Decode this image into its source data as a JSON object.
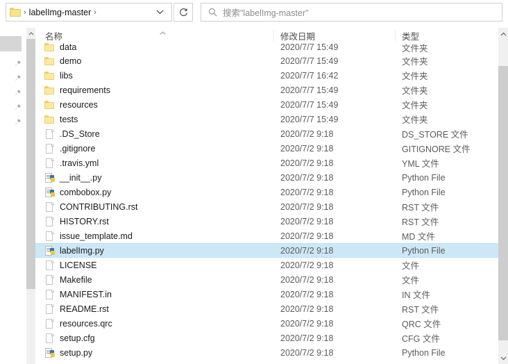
{
  "window": {
    "title": "labelImg-master"
  },
  "addressbar": {
    "folder_icon": "folder-icon",
    "separator": "›",
    "path_label": "labelImg-master",
    "trailing_separator": "›",
    "dropdown_icon": "chevron-down-icon",
    "refresh_icon": "refresh-icon"
  },
  "search": {
    "icon": "search-icon",
    "placeholder": "搜索\"labelImg-master\"",
    "value": ""
  },
  "sidebar": {
    "pin_icon": "pin-icon",
    "pin_count": 5
  },
  "columns": {
    "name": "名称",
    "date": "修改日期",
    "type": "类型",
    "sort_indicator": "sort-ascending-icon"
  },
  "colors": {
    "selection": "#cce8f7",
    "selection_border": "#b8e0f5",
    "folder": "#fde9a4",
    "header_text": "#4a4a4a",
    "row_text": "#1a1a1a",
    "secondary_text": "#5b5b5b"
  },
  "scrollbars": {
    "left_up_icon": "chevron-up-icon",
    "right_up_icon": "chevron-up-icon",
    "right_down_icon": "chevron-down-icon"
  },
  "files": [
    {
      "name": "data",
      "date": "2020/7/7 15:49",
      "type": "文件夹",
      "icon": "folder-icon",
      "selected": false,
      "clipped": true
    },
    {
      "name": "demo",
      "date": "2020/7/7 15:49",
      "type": "文件夹",
      "icon": "folder-icon",
      "selected": false
    },
    {
      "name": "libs",
      "date": "2020/7/7 16:42",
      "type": "文件夹",
      "icon": "folder-icon",
      "selected": false
    },
    {
      "name": "requirements",
      "date": "2020/7/7 15:49",
      "type": "文件夹",
      "icon": "folder-icon",
      "selected": false
    },
    {
      "name": "resources",
      "date": "2020/7/7 15:49",
      "type": "文件夹",
      "icon": "folder-icon",
      "selected": false
    },
    {
      "name": "tests",
      "date": "2020/7/7 15:49",
      "type": "文件夹",
      "icon": "folder-icon",
      "selected": false
    },
    {
      "name": ".DS_Store",
      "date": "2020/7/2 9:18",
      "type": "DS_STORE 文件",
      "icon": "file-icon",
      "selected": false
    },
    {
      "name": ".gitignore",
      "date": "2020/7/2 9:18",
      "type": "GITIGNORE 文件",
      "icon": "file-icon",
      "selected": false
    },
    {
      "name": ".travis.yml",
      "date": "2020/7/2 9:18",
      "type": "YML 文件",
      "icon": "file-icon",
      "selected": false
    },
    {
      "name": "__init__.py",
      "date": "2020/7/2 9:18",
      "type": "Python File",
      "icon": "python-file-icon",
      "selected": false
    },
    {
      "name": "combobox.py",
      "date": "2020/7/2 9:18",
      "type": "Python File",
      "icon": "python-file-icon",
      "selected": false
    },
    {
      "name": "CONTRIBUTING.rst",
      "date": "2020/7/2 9:18",
      "type": "RST 文件",
      "icon": "file-icon",
      "selected": false
    },
    {
      "name": "HISTORY.rst",
      "date": "2020/7/2 9:18",
      "type": "RST 文件",
      "icon": "file-icon",
      "selected": false
    },
    {
      "name": "issue_template.md",
      "date": "2020/7/2 9:18",
      "type": "MD 文件",
      "icon": "file-icon",
      "selected": false
    },
    {
      "name": "labelImg.py",
      "date": "2020/7/2 9:18",
      "type": "Python File",
      "icon": "python-file-icon",
      "selected": true
    },
    {
      "name": "LICENSE",
      "date": "2020/7/2 9:18",
      "type": "文件",
      "icon": "file-icon",
      "selected": false
    },
    {
      "name": "Makefile",
      "date": "2020/7/2 9:18",
      "type": "文件",
      "icon": "file-icon",
      "selected": false
    },
    {
      "name": "MANIFEST.in",
      "date": "2020/7/2 9:18",
      "type": "IN 文件",
      "icon": "file-icon",
      "selected": false
    },
    {
      "name": "README.rst",
      "date": "2020/7/2 9:18",
      "type": "RST 文件",
      "icon": "file-icon",
      "selected": false
    },
    {
      "name": "resources.qrc",
      "date": "2020/7/2 9:18",
      "type": "QRC 文件",
      "icon": "file-icon",
      "selected": false
    },
    {
      "name": "setup.cfg",
      "date": "2020/7/2 9:18",
      "type": "CFG 文件",
      "icon": "file-icon",
      "selected": false
    },
    {
      "name": "setup.py",
      "date": "2020/7/2 9:18",
      "type": "Python File",
      "icon": "python-file-icon",
      "selected": false
    }
  ]
}
